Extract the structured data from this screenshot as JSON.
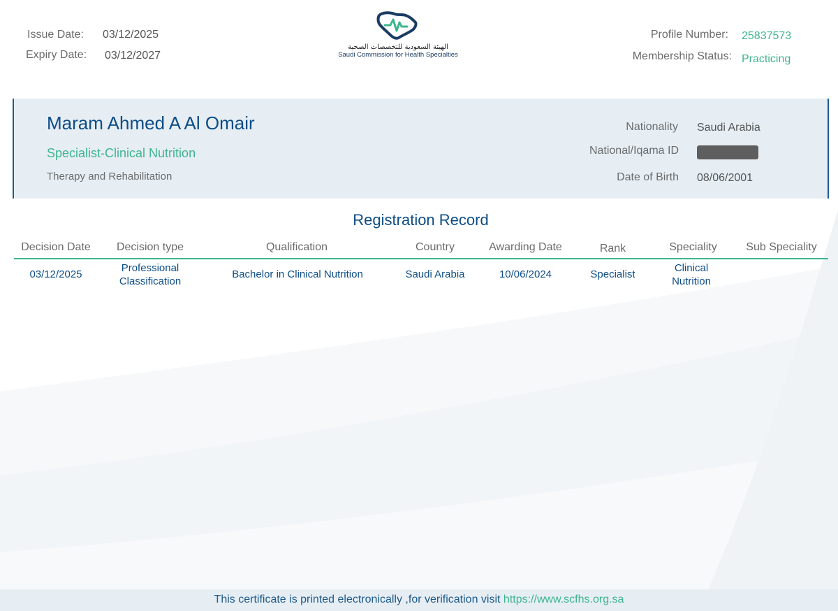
{
  "header": {
    "issue_label": "Issue Date:",
    "issue_value": "03/12/2025",
    "expiry_label": "Expiry Date:",
    "expiry_value": "03/12/2027",
    "profile_label": "Profile Number:",
    "profile_value": "25837573",
    "membership_label": "Membership Status:",
    "membership_value": "Practicing"
  },
  "logo": {
    "arabic": "الهيئة السعودية للتخصصات الصحية",
    "english": "Saudi Commission for Health Specialties"
  },
  "person": {
    "name": "Maram Ahmed A Al Omair",
    "title": "Specialist-Clinical Nutrition",
    "department": "Therapy and Rehabilitation",
    "nationality_label": "Nationality",
    "nationality_value": "Saudi Arabia",
    "id_label": "National/Iqama ID",
    "dob_label": "Date of Birth",
    "dob_value": "08/06/2001"
  },
  "registration": {
    "title": "Registration Record",
    "columns": [
      "Decision Date",
      "Decision type",
      "Qualification",
      "Country",
      "Awarding Date",
      "Rank",
      "Speciality",
      "Sub Speciality"
    ],
    "row": {
      "decision_date": "03/12/2025",
      "decision_type_line1": "Professional",
      "decision_type_line2": "Classification",
      "qualification": "Bachelor in Clinical Nutrition",
      "country": "Saudi Arabia",
      "awarding_date": "10/06/2024",
      "rank": "Specialist",
      "speciality_line1": "Clinical",
      "speciality_line2": "Nutrition"
    }
  },
  "footer": {
    "text": "This certificate is printed electronically ,for verification visit",
    "link": "https://www.scfhs.org.sa"
  },
  "colors": {
    "primary_blue": "#0d4d86",
    "accent_green": "#3fb58f",
    "card_bg": "#e6eef4"
  }
}
